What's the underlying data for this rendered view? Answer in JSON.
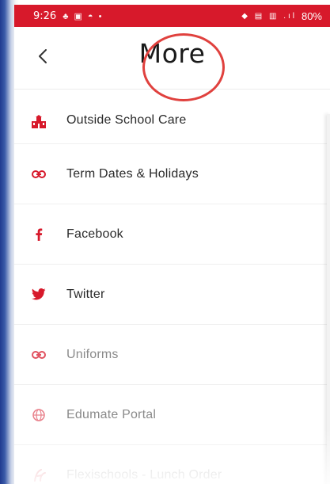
{
  "status_bar": {
    "time": "9:26",
    "left_icons": "♣ ▣ ◓ •",
    "right_icons": "◆ ▤ ▥ .ıl",
    "battery": "80%"
  },
  "header": {
    "title": "More"
  },
  "menu": {
    "items": [
      {
        "label": "Outside School Care",
        "icon": "school-icon"
      },
      {
        "label": "Term Dates & Holidays",
        "icon": "link-icon"
      },
      {
        "label": "Facebook",
        "icon": "facebook-icon"
      },
      {
        "label": "Twitter",
        "icon": "twitter-icon"
      },
      {
        "label": "Uniforms",
        "icon": "link-icon"
      },
      {
        "label": "Edumate Portal",
        "icon": "globe-icon"
      },
      {
        "label": "Flexischools - Lunch Order",
        "icon": "flexischools-icon"
      }
    ]
  },
  "colors": {
    "brand_red": "#d7192b",
    "highlight_circle": "#e0413e"
  }
}
